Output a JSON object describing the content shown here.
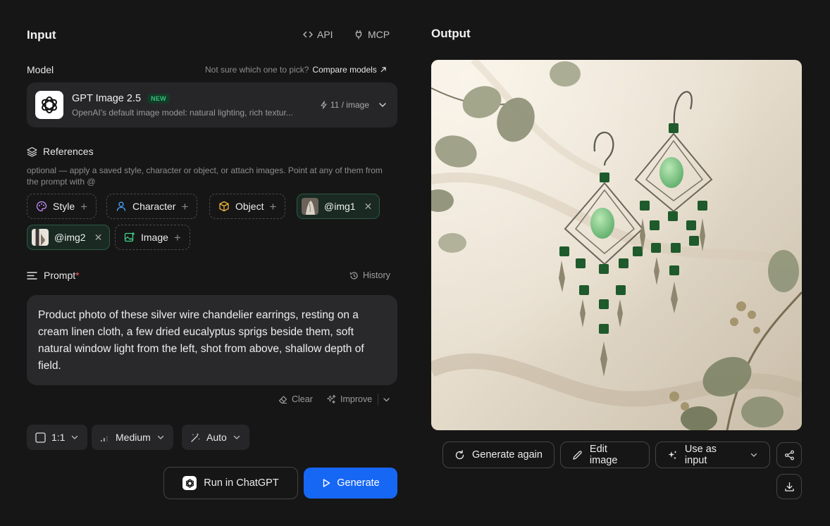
{
  "input": {
    "title": "Input",
    "api_label": "API",
    "mcp_label": "MCP"
  },
  "model": {
    "section_label": "Model",
    "helper_text": "Not sure which one to pick?",
    "compare_link": "Compare models",
    "name": "GPT Image 2.5",
    "badge": "NEW",
    "description": "OpenAI's default image model: natural lighting, rich textur...",
    "cost": "11 / image"
  },
  "references": {
    "section_label": "References",
    "hint": "optional — apply a saved style, character or object, or attach images. Point at any of them from the prompt with @",
    "chips": {
      "style": "Style",
      "character": "Character",
      "object": "Object",
      "img1": "@img1",
      "img2": "@img2",
      "image": "Image"
    }
  },
  "prompt": {
    "section_label": "Prompt",
    "required_mark": "*",
    "history_label": "History",
    "text": "Product photo of these silver wire chandelier earrings, resting on a cream linen cloth, a few dried eucalyptus sprigs beside them, soft natural window light from the left, shot from above, shallow depth of field.",
    "clear_label": "Clear",
    "improve_label": "Improve"
  },
  "settings": {
    "aspect": "1:1",
    "quality": "Medium",
    "style": "Auto"
  },
  "actions": {
    "run_chatgpt": "Run in ChatGPT",
    "generate": "Generate"
  },
  "output": {
    "title": "Output",
    "generate_again": "Generate again",
    "edit_image": "Edit image",
    "use_as_input": "Use as input"
  },
  "colors": {
    "accent": "#1767f5",
    "background": "#161616",
    "card": "#262629",
    "new_badge": "#34c27a"
  }
}
